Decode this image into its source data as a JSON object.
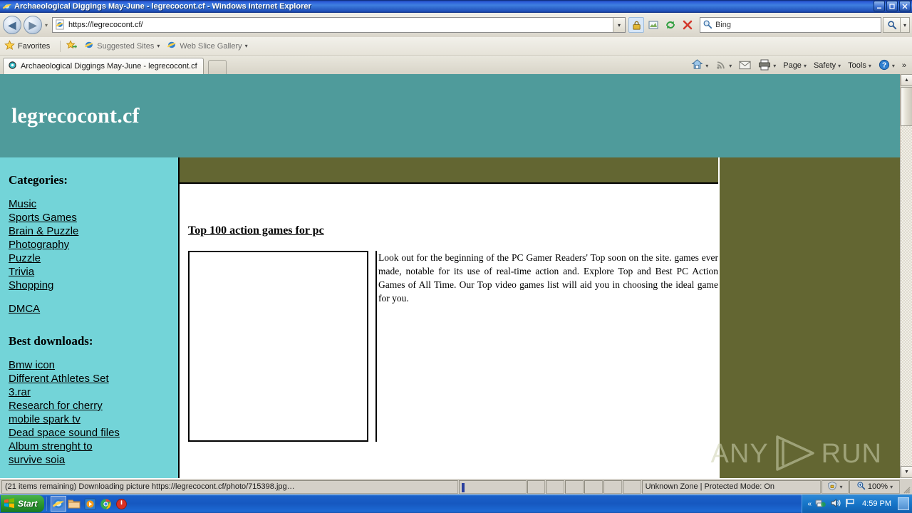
{
  "window": {
    "title": "Archaeological Diggings May-June - legrecocont.cf - Windows Internet Explorer",
    "minimize": "_",
    "maximize": "□",
    "close": "✕"
  },
  "navbar": {
    "back_icon": "back-arrow-icon",
    "forward_icon": "forward-arrow-icon",
    "history_caret": "▾",
    "address_value": "https://legrecocont.cf/",
    "address_dropdown_caret": "▾",
    "icons": {
      "lock": "lock-icon",
      "compatibility": "compatibility-view-icon",
      "refresh": "refresh-icon",
      "stop": "stop-icon"
    },
    "search_placeholder": "Bing",
    "search_go_caret": "▾"
  },
  "favorites_bar": {
    "favorites_label": "Favorites",
    "items": [
      {
        "label": "Suggested Sites",
        "caret": "▾"
      },
      {
        "label": "Web Slice Gallery",
        "caret": "▾"
      }
    ]
  },
  "tabs": {
    "items": [
      {
        "label": "Archaeological Diggings May-June - legrecocont.cf"
      }
    ],
    "new_tab_label": ""
  },
  "command_bar": {
    "items": [
      {
        "name": "home",
        "label": "",
        "icon": "home-icon",
        "caret": "▾"
      },
      {
        "name": "feeds",
        "label": "",
        "icon": "rss-feed-icon",
        "caret": "▾"
      },
      {
        "name": "mail",
        "label": "",
        "icon": "mail-icon",
        "caret": ""
      },
      {
        "name": "print",
        "label": "",
        "icon": "printer-icon",
        "caret": "▾"
      },
      {
        "name": "page",
        "label": "Page",
        "icon": "",
        "caret": "▾"
      },
      {
        "name": "safety",
        "label": "Safety",
        "icon": "",
        "caret": "▾"
      },
      {
        "name": "tools",
        "label": "Tools",
        "icon": "",
        "caret": "▾"
      },
      {
        "name": "help",
        "label": "",
        "icon": "help-icon",
        "caret": "▾"
      }
    ],
    "overflow": "»"
  },
  "page": {
    "site_title": "legrecocont.cf",
    "colors": {
      "header_teal": "#4f9b9b",
      "sidebar_cyan": "#73d4d8",
      "olive": "#636632"
    },
    "sidebar": {
      "categories_heading": "Categories:",
      "categories": [
        "Music",
        "Sports Games",
        "Brain & Puzzle",
        "Photography",
        "Puzzle",
        "Trivia",
        "Shopping"
      ],
      "dmca_link": "DMCA",
      "downloads_heading": "Best downloads:",
      "downloads": [
        "Bmw icon",
        "Different Athletes Set",
        "3.rar",
        "Research for cherry",
        "mobile spark tv",
        "Dead space sound files",
        "Album strenght to",
        "survive soia"
      ]
    },
    "article": {
      "title": "Top 100 action games for pc",
      "image_alt": "",
      "body": "Look out for the beginning of the PC Gamer Readers' Top soon on the site. games ever made, notable for its use of real-time action and. Explore Top and Best PC Action Games of All Time. Our Top video games list will aid you in choosing the ideal game for you."
    }
  },
  "watermark": {
    "left_text": "ANY",
    "right_text": "RUN"
  },
  "scrollbar": {
    "up_caret": "▲",
    "down_caret": "▼"
  },
  "status_bar": {
    "status_text": "(21 items remaining) Downloading picture https://legrecocont.cf/photo/715398.jpg…",
    "zone_text": "Unknown Zone | Protected Mode: On",
    "zone_icon": "protected-mode-icon",
    "zone_caret": "▾",
    "zoom_icon": "zoom-icon",
    "zoom_level": "100%",
    "zoom_caret": "▾"
  },
  "taskbar": {
    "start_label": "Start",
    "quick_launch": [
      {
        "name": "internet-explorer",
        "icon": "ie-icon"
      },
      {
        "name": "windows-explorer",
        "icon": "folder-icon"
      },
      {
        "name": "media-player",
        "icon": "media-player-icon"
      },
      {
        "name": "google-chrome",
        "icon": "chrome-icon"
      },
      {
        "name": "shutdown-tool",
        "icon": "power-icon"
      }
    ],
    "tray": {
      "chevron": "«",
      "network_icon": "network-icon",
      "volume_icon": "volume-icon",
      "action_icon": "flag-icon",
      "clock": "4:59 PM"
    }
  }
}
